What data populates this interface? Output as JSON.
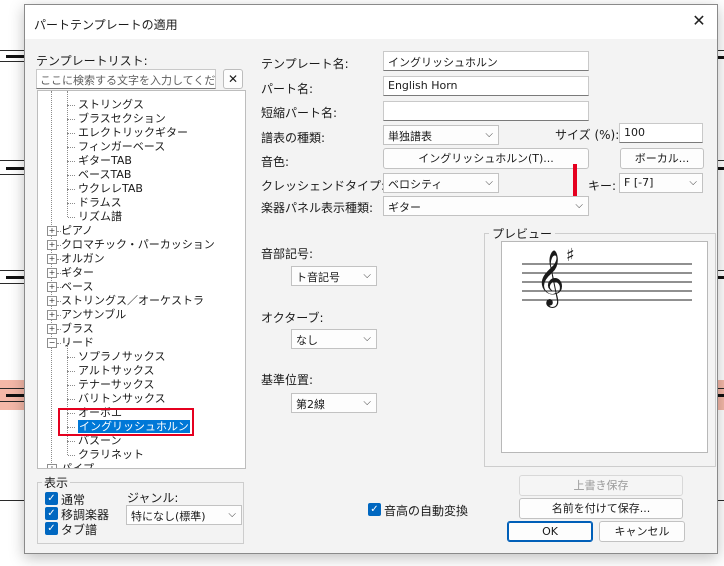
{
  "dialog": {
    "title": "パートテンプレートの適用",
    "close_glyph": "✕"
  },
  "left": {
    "template_list_label": "テンプレートリスト:",
    "search_placeholder": "ここに検索する文字を入力してください",
    "clear_glyph": "✕",
    "tree_items": [
      {
        "label": "ストリングス",
        "level": 2
      },
      {
        "label": "ブラスセクション",
        "level": 2
      },
      {
        "label": "エレクトリックギター",
        "level": 2
      },
      {
        "label": "フィンガーベース",
        "level": 2
      },
      {
        "label": "ギターTAB",
        "level": 2
      },
      {
        "label": "ベースTAB",
        "level": 2
      },
      {
        "label": "ウクレレTAB",
        "level": 2
      },
      {
        "label": "ドラムス",
        "level": 2
      },
      {
        "label": "リズム譜",
        "level": 2
      },
      {
        "label": "ピアノ",
        "level": 1,
        "toggle": "+"
      },
      {
        "label": "クロマチック・パーカッション",
        "level": 1,
        "toggle": "+"
      },
      {
        "label": "オルガン",
        "level": 1,
        "toggle": "+"
      },
      {
        "label": "ギター",
        "level": 1,
        "toggle": "+"
      },
      {
        "label": "ベース",
        "level": 1,
        "toggle": "+"
      },
      {
        "label": "ストリングス／オーケストラ",
        "level": 1,
        "toggle": "+"
      },
      {
        "label": "アンサンブル",
        "level": 1,
        "toggle": "+"
      },
      {
        "label": "ブラス",
        "level": 1,
        "toggle": "+"
      },
      {
        "label": "リード",
        "level": 1,
        "toggle": "−"
      },
      {
        "label": "ソプラノサックス",
        "level": 2
      },
      {
        "label": "アルトサックス",
        "level": 2
      },
      {
        "label": "テナーサックス",
        "level": 2
      },
      {
        "label": "バリトンサックス",
        "level": 2
      },
      {
        "label": "オーボエ",
        "level": 2
      },
      {
        "label": "イングリッシュホルン",
        "level": 2,
        "selected": true
      },
      {
        "label": "バスーン",
        "level": 2
      },
      {
        "label": "クラリネット",
        "level": 2
      },
      {
        "label": "パイプ",
        "level": 1,
        "toggle": "+"
      }
    ],
    "display_group": {
      "legend": "表示",
      "checkboxes": [
        {
          "label": "通常",
          "checked": true
        },
        {
          "label": "移調楽器",
          "checked": true
        },
        {
          "label": "タブ譜",
          "checked": true
        }
      ],
      "genre_label": "ジャンル:",
      "genre_value": "特になし(標準)"
    }
  },
  "form": {
    "template_name_label": "テンプレート名:",
    "template_name_value": "イングリッシュホルン",
    "part_name_label": "パート名:",
    "part_name_value": "English Horn",
    "short_part_name_label": "短縮パート名:",
    "short_part_name_value": "",
    "staff_type_label": "譜表の種類:",
    "staff_type_value": "単独譜表",
    "size_label": "サイズ (%):",
    "size_value": "100",
    "tone_label": "音色:",
    "tone_button": "イングリッシュホルン(T)...",
    "vocal_button": "ボーカル...",
    "crescendo_label": "クレッシェンドタイプ:",
    "crescendo_value": "ベロシティ",
    "key_label": "キー:",
    "key_value": "F [-7]",
    "panel_label": "楽器パネル表示種類:",
    "panel_value": "ギター",
    "clef_label": "音部記号:",
    "clef_value": "ト音記号",
    "octave_label": "オクターブ:",
    "octave_value": "なし",
    "base_pos_label": "基準位置:",
    "base_pos_value": "第2線",
    "preview_label": "プレビュー",
    "auto_transpose_label": "音高の自動変換",
    "auto_transpose_checked": true
  },
  "buttons": {
    "overwrite": "上書き保存",
    "save_as": "名前を付けて保存...",
    "ok": "OK",
    "cancel": "キャンセル"
  },
  "glyphs": {
    "chevron": "⌵",
    "check": "✓",
    "treble_clef": "𝄞",
    "sharp": "♯"
  },
  "colors": {
    "selection": "#0078d7",
    "checkbox": "#0067c0",
    "highlight_box": "#e5001f"
  }
}
